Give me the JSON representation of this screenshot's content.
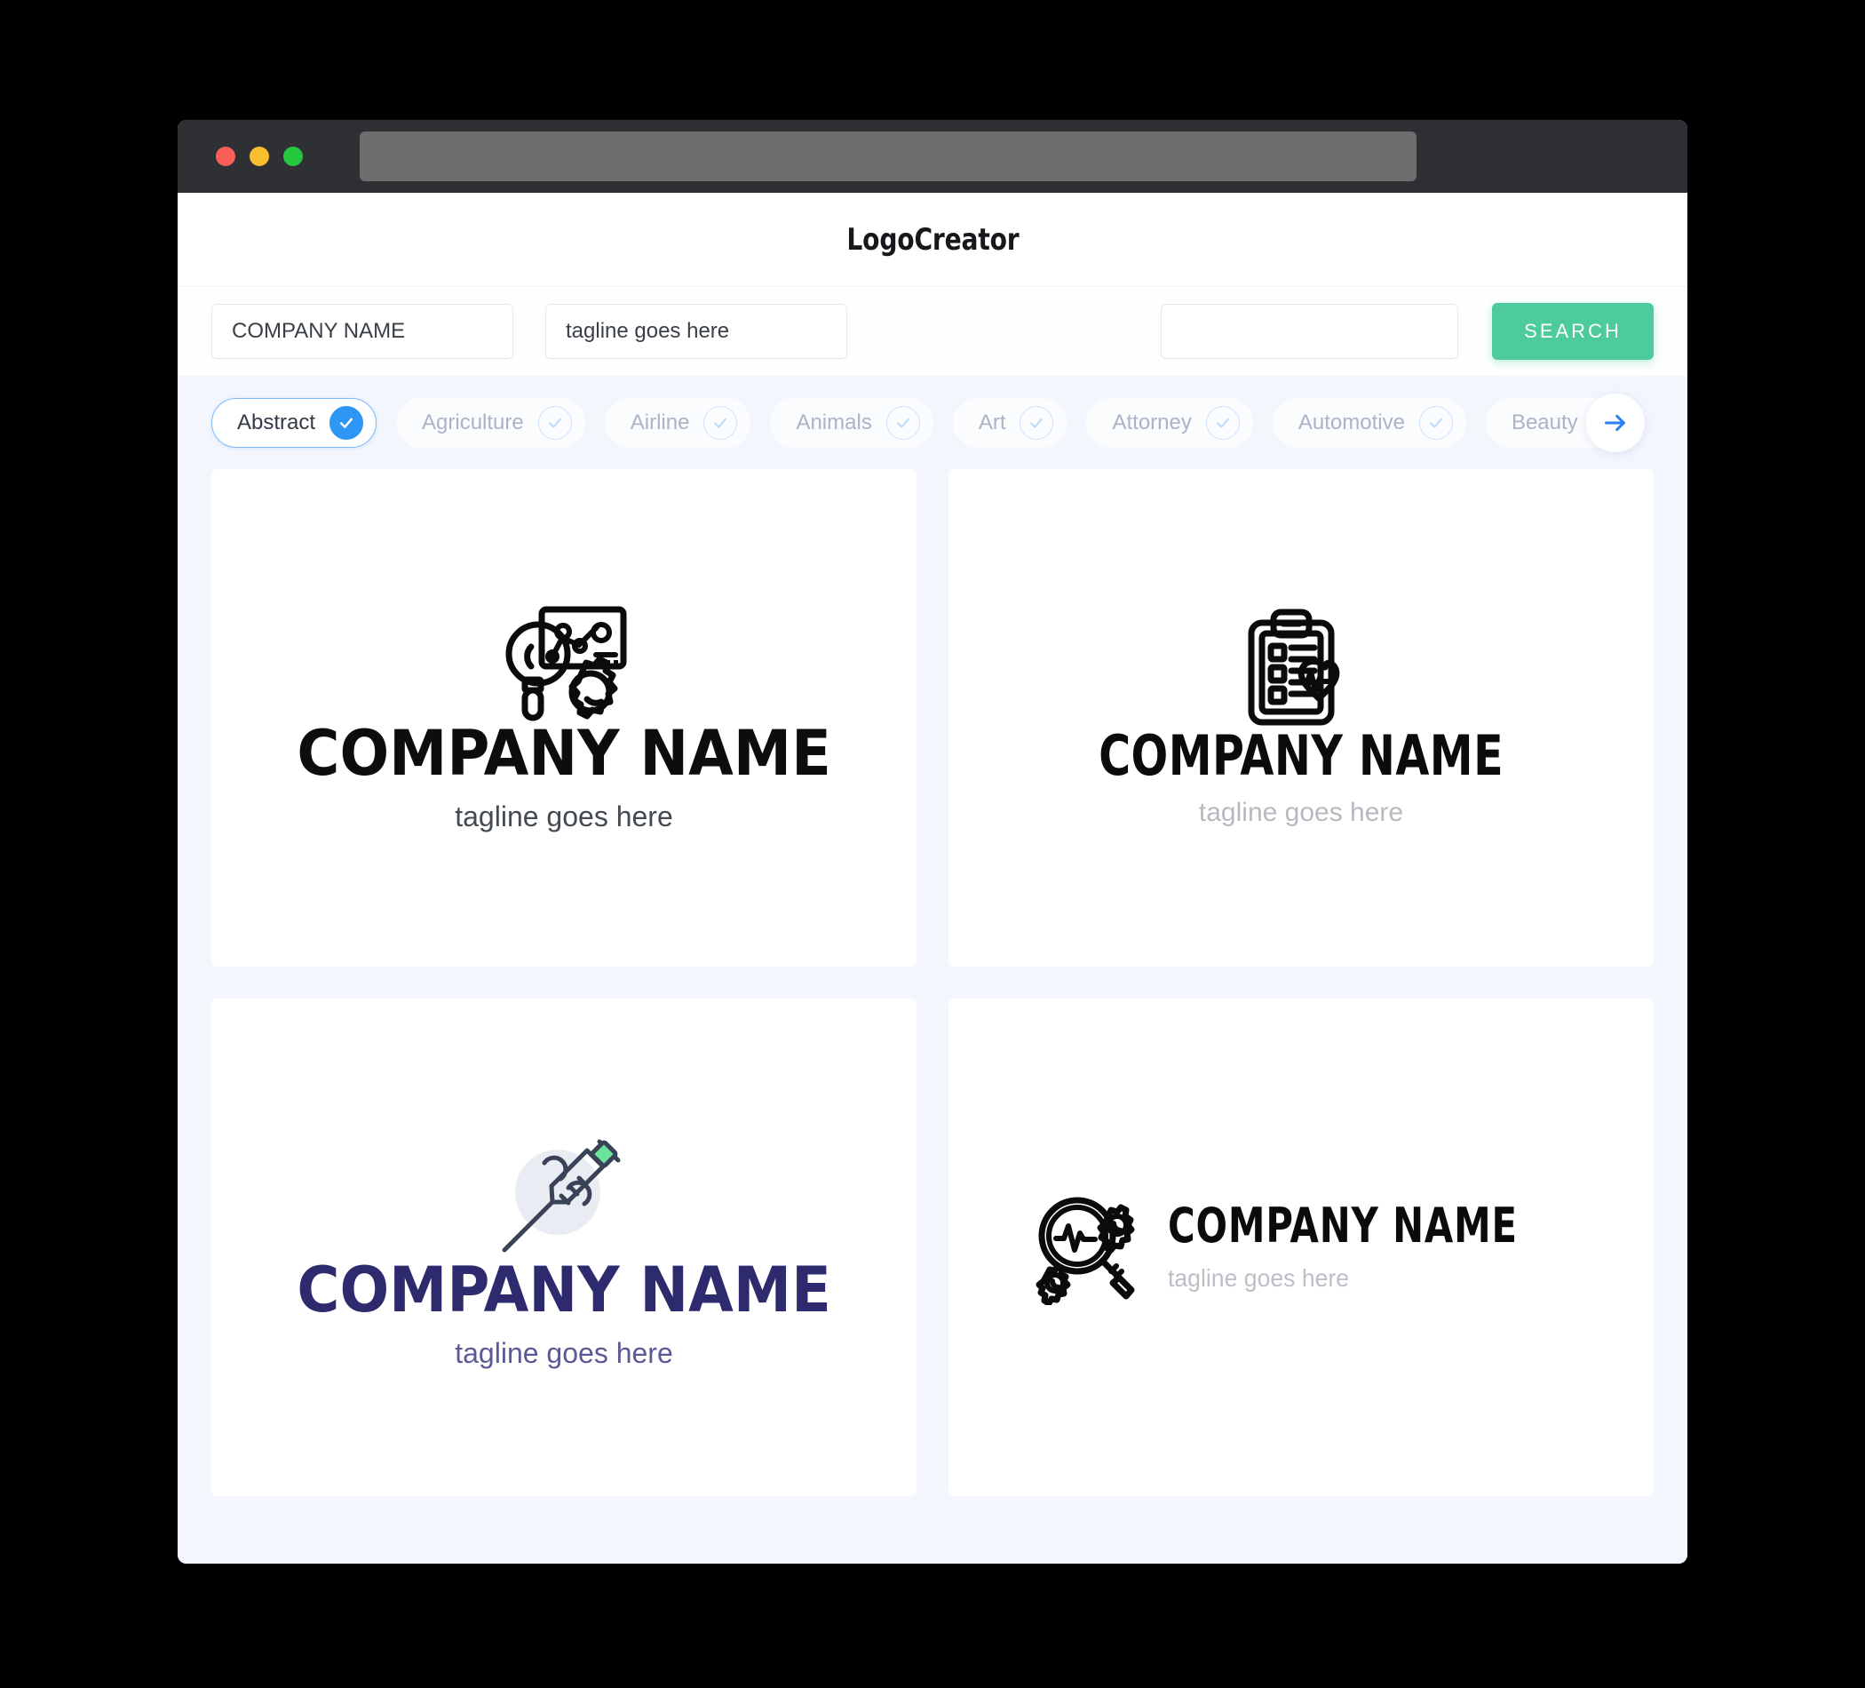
{
  "window": {
    "traffic_lights": [
      {
        "name": "close",
        "color": "#F95E57"
      },
      {
        "name": "minimize",
        "color": "#F9BD2E"
      },
      {
        "name": "maximize",
        "color": "#26C63F"
      }
    ],
    "url_bar_value": ""
  },
  "header": {
    "app_title": "LogoCreator"
  },
  "search": {
    "company_name_value": "COMPANY NAME",
    "company_name_placeholder": "COMPANY NAME",
    "tagline_value": "tagline goes here",
    "tagline_placeholder": "tagline goes here",
    "keyword_value": "",
    "keyword_placeholder": "",
    "search_button_label": "SEARCH",
    "search_button_color": "#4ECB9C"
  },
  "categories": {
    "accent_color": "#2E97F5",
    "next_icon": "arrow-right-icon",
    "items": [
      {
        "label": "Abstract",
        "selected": true
      },
      {
        "label": "Agriculture",
        "selected": false
      },
      {
        "label": "Airline",
        "selected": false
      },
      {
        "label": "Animals",
        "selected": false
      },
      {
        "label": "Art",
        "selected": false
      },
      {
        "label": "Attorney",
        "selected": false
      },
      {
        "label": "Automotive",
        "selected": false
      },
      {
        "label": "Beauty",
        "selected": false
      }
    ]
  },
  "results": [
    {
      "company_name": "COMPANY NAME",
      "tagline": "tagline goes here",
      "icon": "magnifier-chart-gear-icon",
      "layout": "stacked",
      "name_color": "#0D0D0D",
      "tagline_color": "#444A52"
    },
    {
      "company_name": "COMPANY NAME",
      "tagline": "tagline goes here",
      "icon": "clipboard-heartbeat-icon",
      "layout": "stacked",
      "name_color": "#0B0B0B",
      "tagline_color": "#B6BAC0"
    },
    {
      "company_name": "COMPANY NAME",
      "tagline": "tagline goes here",
      "icon": "syringe-icon",
      "layout": "stacked",
      "name_color": "#2D2A6E",
      "tagline_color": "#5C5A96"
    },
    {
      "company_name": "COMPANY NAME",
      "tagline": "tagline goes here",
      "icon": "magnifier-heartbeat-gears-icon",
      "layout": "horizontal",
      "name_color": "#0B0B0B",
      "tagline_color": "#BCC0C6"
    }
  ]
}
